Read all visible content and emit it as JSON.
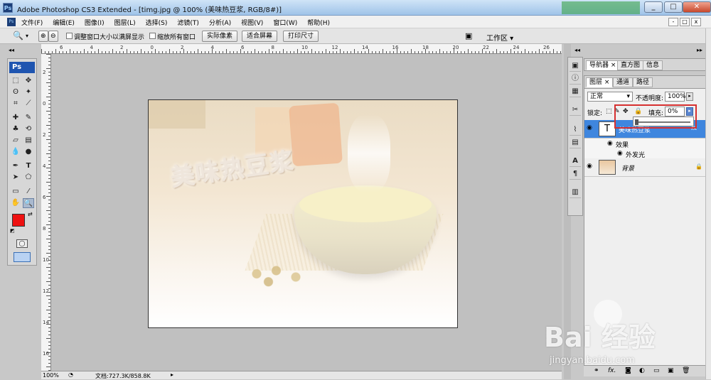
{
  "window": {
    "title": "Adobe Photoshop CS3 Extended - [timg.jpg @ 100% (美味热豆浆, RGB/8#)]",
    "logo": "Ps",
    "controls": {
      "minimize": "_",
      "maximize": "□",
      "close": "✕"
    }
  },
  "menu": {
    "logo": "Ps",
    "items": [
      "文件(F)",
      "编辑(E)",
      "图像(I)",
      "图层(L)",
      "选择(S)",
      "滤镜(T)",
      "分析(A)",
      "视图(V)",
      "窗口(W)",
      "帮助(H)"
    ],
    "doc_controls": [
      "-",
      "□",
      "x"
    ]
  },
  "options": {
    "resize_windows_label": "调整窗口大小以满屏显示",
    "zoom_all_label": "缩放所有窗口",
    "actual_pixels": "实际像素",
    "fit_screen": "适合屏幕",
    "print_size": "打印尺寸",
    "workspace": "工作区 ▾"
  },
  "toolbox": {
    "badge": "Ps",
    "foreground_color": "#ee1111",
    "background_color": "#ee1111"
  },
  "rulers": {
    "top": [
      "6",
      "4",
      "2",
      "0",
      "2",
      "4",
      "6",
      "8",
      "10",
      "12",
      "14",
      "16",
      "18",
      "20",
      "22",
      "24",
      "26"
    ],
    "left": [
      "2",
      "0",
      "2",
      "4",
      "6",
      "8",
      "10",
      "12",
      "14",
      "16"
    ]
  },
  "document": {
    "art_text": "美味热豆浆"
  },
  "status": {
    "zoom": "100%",
    "doc_info": "文档:727.3K/858.8K"
  },
  "nav_panel": {
    "tabs": [
      "导航器 ×",
      "直方图",
      "信息"
    ]
  },
  "layers_panel": {
    "tabs": [
      "图层 ×",
      "通道",
      "路径"
    ],
    "blend_mode": "正常",
    "opacity_label": "不透明度:",
    "opacity_value": "100%",
    "lock_label": "锁定:",
    "fill_label": "填充:",
    "fill_value": "0%",
    "layers": [
      {
        "name": "美味热豆浆",
        "selected": true,
        "fx": "fx"
      },
      {
        "name": "效果",
        "sub": true
      },
      {
        "name": "外发光",
        "sub2": true
      },
      {
        "name": "背景",
        "lock": true
      }
    ]
  },
  "watermark": {
    "text": "Bai 经验",
    "url": "jingyan.baidu.com"
  }
}
